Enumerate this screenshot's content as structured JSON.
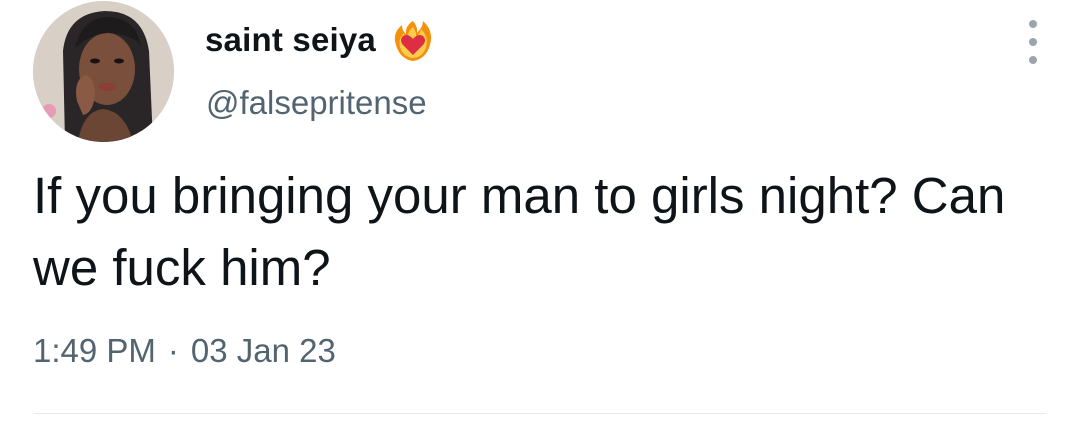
{
  "tweet": {
    "display_name": "saint seiya",
    "name_emoji": "heart-on-fire-icon",
    "handle": "@falsepritense",
    "text": "If you bringing your man to girls night? Can we fuck him?",
    "time": "1:49 PM",
    "separator": "·",
    "date": "03 Jan 23"
  },
  "colors": {
    "text_primary": "#0f1419",
    "text_secondary": "#536471",
    "divider": "#e7e9ea"
  }
}
